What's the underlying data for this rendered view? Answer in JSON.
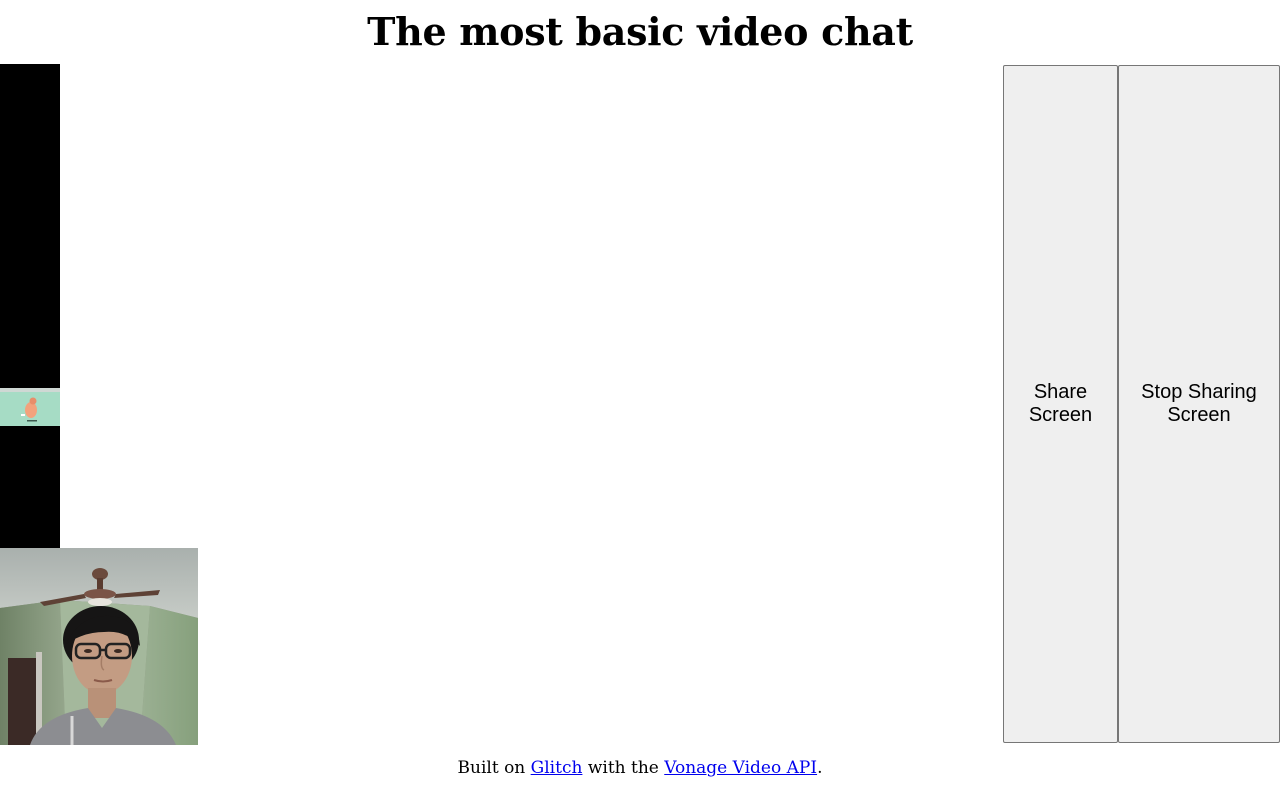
{
  "page": {
    "title": "The most basic video chat"
  },
  "video": {
    "remote_stream": "remote-screen-share-stream",
    "self_view": "local-camera-stream"
  },
  "controls": {
    "share_label": "Share Screen",
    "stop_label": "Stop Sharing Screen"
  },
  "footer": {
    "prefix": "Built on ",
    "glitch_link": "Glitch",
    "middle": " with the ",
    "vonage_link": "Vonage Video API",
    "suffix": "."
  },
  "colors": {
    "button_bg": "#efefef",
    "button_border": "#767676",
    "link": "#0000ee",
    "video_bg": "#000000",
    "screen_thumb_mint": "#a6dcc5"
  }
}
